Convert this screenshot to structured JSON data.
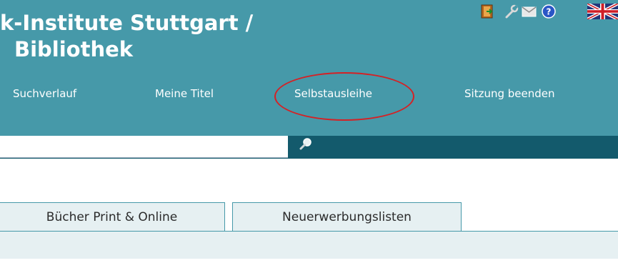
{
  "header": {
    "title_line1": "k-Institute Stuttgart /",
    "title_line2": "Bibliothek",
    "icons": [
      "logout-door-icon",
      "wrench-settings-icon",
      "envelope-mail-icon",
      "help-question-icon",
      "uk-flag-icon"
    ]
  },
  "nav": {
    "items": [
      {
        "label": "Suchverlauf"
      },
      {
        "label": "Meine Titel"
      },
      {
        "label": "Selbstausleihe"
      },
      {
        "label": "Sitzung beenden"
      }
    ],
    "highlighted": "Selbstausleihe"
  },
  "search": {
    "value": "",
    "placeholder": "",
    "button_icon": "magnifier-icon"
  },
  "tabs": [
    {
      "label": "Bücher Print & Online"
    },
    {
      "label": "Neuerwerbungslisten"
    }
  ],
  "colors": {
    "header_bg": "#4699a9",
    "search_bar_bg": "#135a6c",
    "tab_bg": "#e6f0f2",
    "highlight_ring": "#d52125"
  }
}
